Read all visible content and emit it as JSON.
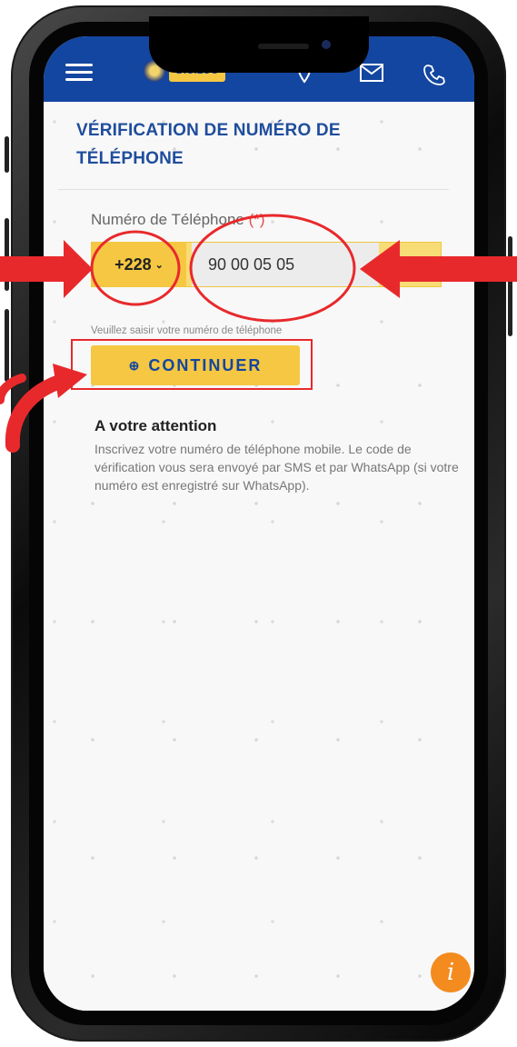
{
  "header": {
    "logo_text": "DIGILOG",
    "icons": [
      "menu-icon",
      "map-pin-icon",
      "mail-icon",
      "phone-icon"
    ]
  },
  "page": {
    "title": "VÉRIFICATION DE NUMÉRO DE TÉLÉPHONE",
    "phone_label": "Numéro de Téléphone",
    "required_mark": "(*)",
    "country_code": "+228",
    "chevron": "⌄",
    "phone_value": "90 00 05 05",
    "hint": "Veuillez saisir votre numéro de téléphone",
    "continue_label": "CONTINUER",
    "continue_icon": "⊕"
  },
  "attention": {
    "title": "A votre attention",
    "text": "Inscrivez votre numéro de téléphone mobile. Le code de vérification vous sera envoyé par SMS et par WhatsApp (si votre numéro est enregistré sur WhatsApp)."
  },
  "info_button": {
    "glyph": "i"
  },
  "colors": {
    "brand_blue": "#1346a0",
    "accent_yellow": "#f5c742",
    "annotation_red": "#e8292c",
    "info_orange": "#f38b1e"
  }
}
